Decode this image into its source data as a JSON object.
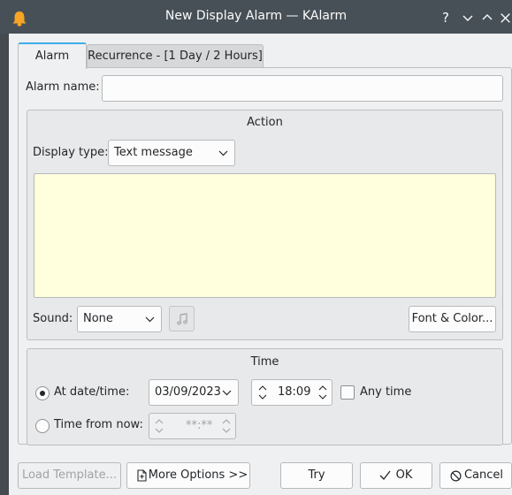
{
  "window": {
    "title": "New Display Alarm — KAlarm",
    "help_glyph": "?",
    "minimize_glyph": "⌄",
    "maximize_glyph": "^",
    "close_glyph": "✕"
  },
  "tabs": [
    {
      "label": "Alarm",
      "active": true
    },
    {
      "label": "Recurrence - [1 Day / 2 Hours]",
      "active": false
    }
  ],
  "alarm_name": {
    "label": "Alarm name:",
    "value": ""
  },
  "action": {
    "title": "Action",
    "display_type_label": "Display type:",
    "display_type_value": "Text message",
    "message_text": "",
    "message_bg": "#ffffdd",
    "sound_label": "Sound:",
    "sound_value": "None",
    "font_color_button": "Font & Color..."
  },
  "time": {
    "title": "Time",
    "at_datetime_label": "At date/time:",
    "at_datetime_selected": true,
    "date_value": "03/09/2023",
    "time_value": "18:09",
    "any_time_label": "Any time",
    "any_time_checked": false,
    "time_from_now_label": "Time from now:",
    "time_from_now_value": "**:**"
  },
  "buttons": {
    "load_template": "Load Template...",
    "more_options": "More Options >>",
    "try": "Try",
    "ok": "OK",
    "cancel": "Cancel"
  },
  "colors": {
    "titlebar": "#475057",
    "accent": "#3daee9",
    "window_bg": "#eff0f1"
  }
}
